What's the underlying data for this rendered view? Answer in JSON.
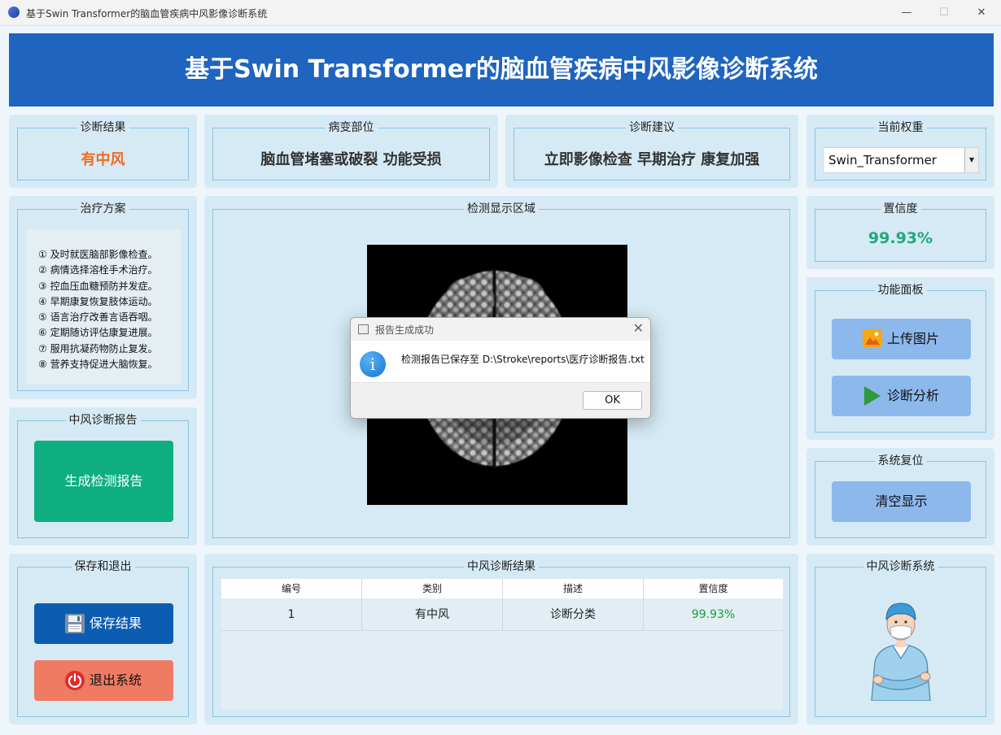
{
  "window": {
    "title": "基于Swin Transformer的脑血管疾病中风影像诊断系统",
    "minimize": "—",
    "maximize": "☐",
    "close": "✕"
  },
  "header": {
    "title": "基于Swin Transformer的脑血管疾病中风影像诊断系统"
  },
  "diagnosis_result": {
    "label": "诊断结果",
    "value": "有中风",
    "color": "#f26b1d"
  },
  "lesion_site": {
    "label": "病变部位",
    "value": "脑血管堵塞或破裂 功能受损"
  },
  "diagnosis_advice": {
    "label": "诊断建议",
    "value": "立即影像检查 早期治疗 康复加强"
  },
  "current_weight": {
    "label": "当前权重",
    "selected": "Swin_Transformer"
  },
  "treatment_plan": {
    "label": "治疗方案",
    "items": [
      "① 及时就医脑部影像检查。",
      "② 病情选择溶栓手术治疗。",
      "③ 控血压血糖预防并发症。",
      "④ 早期康复恢复肢体运动。",
      "⑤ 语言治疗改善言语吞咽。",
      "⑥ 定期随访评估康复进展。",
      "⑦ 服用抗凝药物防止复发。",
      "⑧ 营养支持促进大脑恢复。"
    ]
  },
  "detection_area": {
    "label": "检测显示区域"
  },
  "confidence": {
    "label": "置信度",
    "value": "99.93%",
    "color": "#23a77a"
  },
  "function_panel": {
    "label": "功能面板",
    "upload_label": "上传图片",
    "analyze_label": "诊断分析"
  },
  "system_reset": {
    "label": "系统复位",
    "clear_label": "清空显示"
  },
  "stroke_report": {
    "label": "中风诊断报告",
    "generate_label": "生成检测报告"
  },
  "save_exit": {
    "label": "保存和退出",
    "save_label": "保存结果",
    "exit_label": "退出系统"
  },
  "results_table": {
    "label": "中风诊断结果",
    "columns": [
      "编号",
      "类别",
      "描述",
      "置信度"
    ],
    "rows": [
      {
        "id": "1",
        "category": "有中风",
        "description": "诊断分类",
        "confidence": "99.93%"
      }
    ]
  },
  "system_logo": {
    "label": "中风诊断系统"
  },
  "dialog": {
    "title": "报告生成成功",
    "message": "检测报告已保存至 D:\\Stroke\\reports\\医疗诊断报告.txt",
    "ok_label": "OK"
  }
}
